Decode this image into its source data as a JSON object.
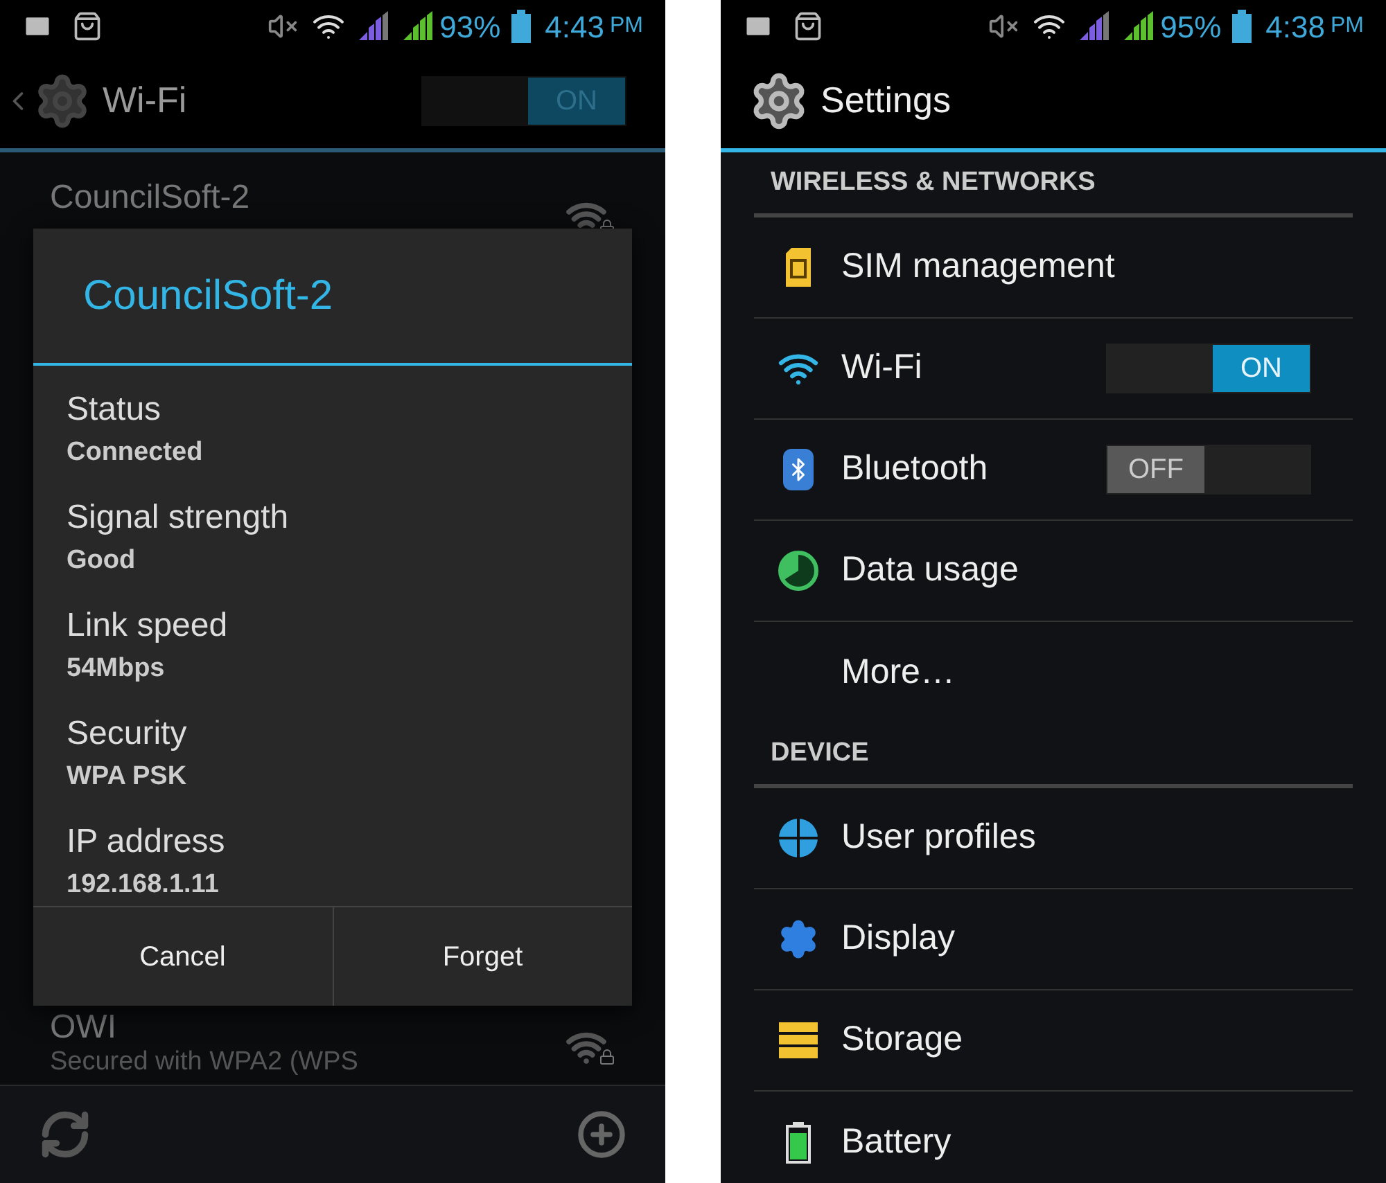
{
  "wifi_screen": {
    "status_bar": {
      "battery": "93%",
      "time": "4:43",
      "ampm": "PM"
    },
    "action_bar": {
      "title": "Wi-Fi",
      "toggle": {
        "label": "ON",
        "on": true
      }
    },
    "networks": [
      {
        "name": "CouncilSoft-2"
      },
      {
        "name": "OWI",
        "detail": "Secured with WPA2 (WPS"
      }
    ],
    "dialog": {
      "title": "CouncilSoft-2",
      "fields": [
        {
          "label": "Status",
          "value": "Connected"
        },
        {
          "label": "Signal strength",
          "value": "Good"
        },
        {
          "label": "Link speed",
          "value": "54Mbps"
        },
        {
          "label": "Security",
          "value": "WPA PSK"
        },
        {
          "label": "IP address",
          "value": "192.168.1.11"
        }
      ],
      "buttons": [
        "Cancel",
        "Forget"
      ]
    }
  },
  "settings_screen": {
    "status_bar": {
      "battery": "95%",
      "time": "4:38",
      "ampm": "PM"
    },
    "title": "Settings",
    "sections": [
      {
        "header": "WIRELESS & NETWORKS",
        "items": [
          {
            "label": "SIM management",
            "kind": "sim"
          },
          {
            "label": "Wi-Fi",
            "kind": "wifi",
            "toggle": {
              "label": "ON",
              "on": true
            }
          },
          {
            "label": "Bluetooth",
            "kind": "bluetooth",
            "toggle": {
              "label": "OFF",
              "on": false
            }
          },
          {
            "label": "Data usage",
            "kind": "data"
          },
          {
            "label": "More…",
            "kind": "more"
          }
        ]
      },
      {
        "header": "DEVICE",
        "items": [
          {
            "label": "User profiles",
            "kind": "profiles"
          },
          {
            "label": "Display",
            "kind": "display"
          },
          {
            "label": "Storage",
            "kind": "storage"
          },
          {
            "label": "Battery",
            "kind": "battery"
          }
        ]
      }
    ]
  }
}
